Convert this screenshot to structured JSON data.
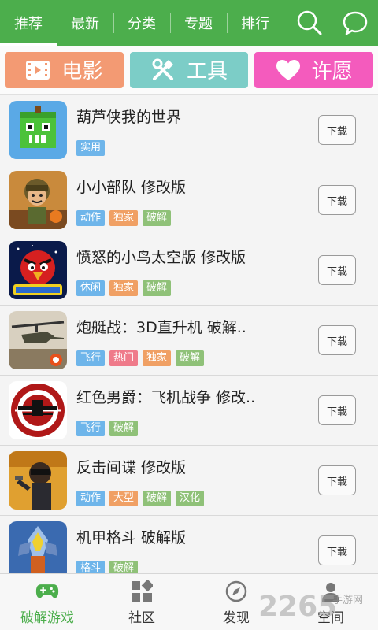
{
  "topnav": {
    "tabs": [
      {
        "label": "推荐",
        "active": true
      },
      {
        "label": "最新",
        "active": false
      },
      {
        "label": "分类",
        "active": false
      },
      {
        "label": "专题",
        "active": false
      },
      {
        "label": "排行",
        "active": false
      }
    ],
    "icons": [
      "search-icon",
      "message-icon"
    ],
    "color": "#4cae4c"
  },
  "categories": [
    {
      "label": "电影",
      "icon": "film-icon",
      "color": "#f39a73"
    },
    {
      "label": "工具",
      "icon": "tools-icon",
      "color": "#7ccdc7"
    },
    {
      "label": "许愿",
      "icon": "heart-icon",
      "color": "#f45bbd"
    }
  ],
  "apps": [
    {
      "name": "葫芦侠我的世界",
      "tags": [
        {
          "text": "实用",
          "color": "#6eb5ea"
        }
      ],
      "button": "下载",
      "icon": "pixel-apple-app-icon"
    },
    {
      "name": "小小部队  修改版",
      "tags": [
        {
          "text": "动作",
          "color": "#6eb5ea"
        },
        {
          "text": "独家",
          "color": "#f0a064"
        },
        {
          "text": "破解",
          "color": "#8fc178"
        }
      ],
      "button": "下载",
      "icon": "soldier-app-icon"
    },
    {
      "name": "愤怒的小鸟太空版  修改版",
      "tags": [
        {
          "text": "休闲",
          "color": "#6eb5ea"
        },
        {
          "text": "独家",
          "color": "#f0a064"
        },
        {
          "text": "破解",
          "color": "#8fc178"
        }
      ],
      "button": "下载",
      "icon": "angry-bird-app-icon"
    },
    {
      "name": "炮艇战：3D直升机  破解..",
      "tags": [
        {
          "text": "飞行",
          "color": "#6eb5ea"
        },
        {
          "text": "热门",
          "color": "#ef7a8a"
        },
        {
          "text": "独家",
          "color": "#f0a064"
        },
        {
          "text": "破解",
          "color": "#8fc178"
        }
      ],
      "button": "下载",
      "icon": "helicopter-app-icon"
    },
    {
      "name": "红色男爵：飞机战争  修改..",
      "tags": [
        {
          "text": "飞行",
          "color": "#6eb5ea"
        },
        {
          "text": "破解",
          "color": "#8fc178"
        }
      ],
      "button": "下载",
      "icon": "red-baron-app-icon"
    },
    {
      "name": "反击间谍    修改版",
      "tags": [
        {
          "text": "动作",
          "color": "#6eb5ea"
        },
        {
          "text": "大型",
          "color": "#f0a064"
        },
        {
          "text": "破解",
          "color": "#8fc178"
        },
        {
          "text": "汉化",
          "color": "#8fc178"
        }
      ],
      "button": "下载",
      "icon": "spy-app-icon"
    },
    {
      "name": "机甲格斗  破解版",
      "tags": [
        {
          "text": "格斗",
          "color": "#6eb5ea"
        },
        {
          "text": "破解",
          "color": "#8fc178"
        }
      ],
      "button": "下载",
      "icon": "mech-app-icon"
    }
  ],
  "bottomnav": [
    {
      "label": "破解游戏",
      "icon": "gamepad-icon",
      "active": true
    },
    {
      "label": "社区",
      "icon": "grid-icon",
      "active": false
    },
    {
      "label": "发现",
      "icon": "compass-icon",
      "active": false
    },
    {
      "label": "空间",
      "icon": "user-icon",
      "active": false
    }
  ],
  "watermark": {
    "number": "2265",
    "text": "手游网"
  }
}
